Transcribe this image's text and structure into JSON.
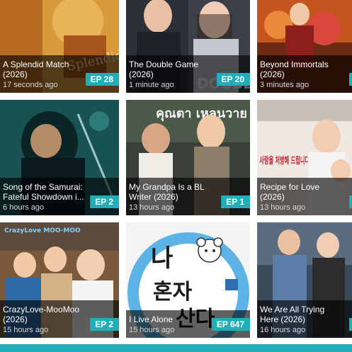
{
  "cards": [
    {
      "title": "A Splendid Match (2026)",
      "time": "17 seconds ago",
      "ep": "EP 28"
    },
    {
      "title": "The Double Game (2026)",
      "time": "1 minute ago",
      "ep": "EP 20"
    },
    {
      "title": "Beyond Immortals (2026)",
      "time": "3 minutes ago",
      "ep": ""
    },
    {
      "title": "Song of the Samurai: Fateful Showdown i...",
      "time": "6 hours ago",
      "ep": "EP 2"
    },
    {
      "title": "My Grandpa Is a BL Writer (2026)",
      "time": "13 hours ago",
      "ep": "EP 1"
    },
    {
      "title": "Recipe for Love (2026)",
      "time": "13 hours ago",
      "ep": ""
    },
    {
      "title": "CrazyLove-MooMoo (2026)",
      "time": "15 hours ago",
      "ep": "EP 2"
    },
    {
      "title": "I Live Alone",
      "time": "15 hours ago",
      "ep": "EP 647"
    },
    {
      "title": "We Are All Trying Here (2026)",
      "time": "16 hours ago",
      "ep": ""
    }
  ],
  "poster_text": {
    "live_alone": [
      "나",
      "혼자",
      "산다"
    ],
    "recipe": "사랑을 처방해 드립니다",
    "crazylove": "CrazyLove MOO-MOO",
    "grandpa": "คุณตา เหลนวาย"
  },
  "colors": {
    "accent": "#20aeb9"
  }
}
